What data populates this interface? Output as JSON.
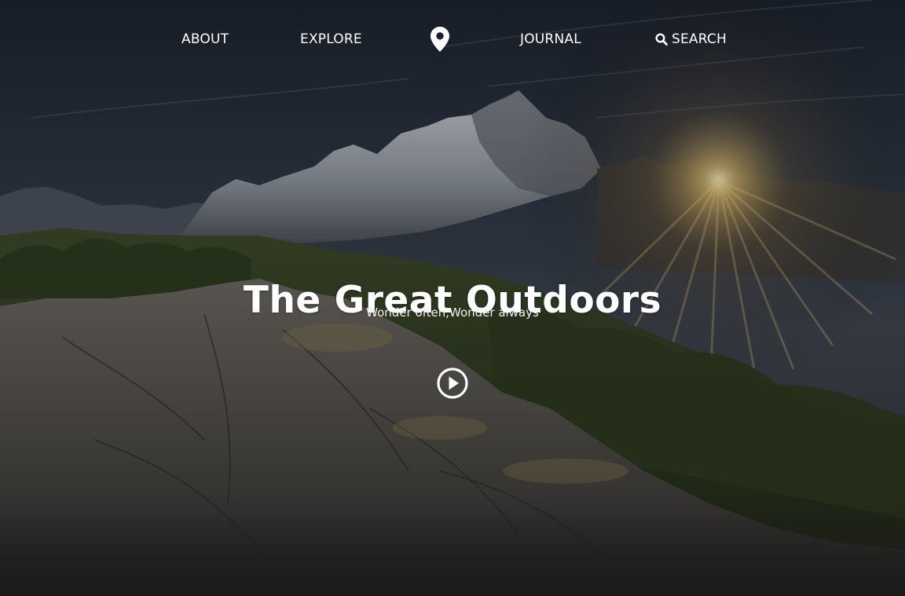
{
  "nav": {
    "items": [
      {
        "label": "ABOUT"
      },
      {
        "label": "EXPLORE"
      },
      {
        "label": "JOURNAL"
      },
      {
        "label": "SEARCH"
      }
    ],
    "logo_icon": "map-marker-icon",
    "search_icon": "search-icon"
  },
  "hero": {
    "title": "The Great Outdoors",
    "subtitle": "Wonder often,Wonder always",
    "play_icon": "play-circle-icon",
    "background": "mountain-sunset-photo"
  },
  "colors": {
    "text": "#ffffff",
    "footer_band": "#1b1b1b",
    "sun": "#f7d27a"
  }
}
